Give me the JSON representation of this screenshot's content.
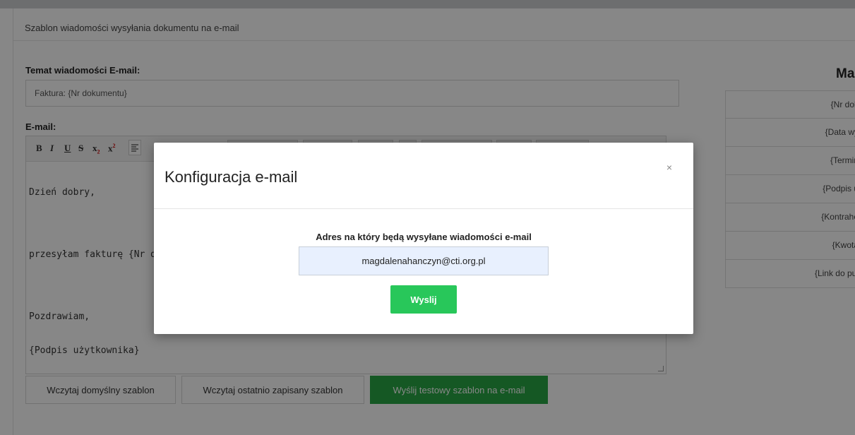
{
  "panel": {
    "title": "Szablon wiadomości wysyłania dokumentu na e-mail",
    "subject_label": "Temat wiadomości E-mail:",
    "subject_value": "Faktura: {Nr dokumentu}",
    "email_label": "E-mail:"
  },
  "toolbar": {
    "bold": "B",
    "italic": "I",
    "underline": "U",
    "strike": "S",
    "subscript": "x",
    "superscript": "x"
  },
  "editor": {
    "lines": [
      "Dzień dobry,",
      "",
      "przesyłam fakturę {Nr dok",
      "",
      "Pozdrawiam,",
      "{Podpis użytkownika}"
    ]
  },
  "buttons": {
    "load_default": "Wczytaj domyślny szablon",
    "load_saved": "Wczytaj ostatnio zapisany szablon",
    "send_test": "Wyślij testowy szablon na e-mail"
  },
  "right": {
    "heading": "Ma",
    "tags": [
      "{Nr dok",
      "{Data wy",
      "{Termin",
      "{Podpis u",
      "{Kontrahe",
      "{Kwota",
      "{Link do pul"
    ]
  },
  "modal": {
    "title": "Konfiguracja e-mail",
    "close": "×",
    "address_label": "Adres na który będą wysyłane wiadomości e-mail",
    "address_value": "magdalenahanczyn@cti.org.pl",
    "send_label": "Wyslij"
  },
  "colors": {
    "overlay": "#000000",
    "green": "#28a745",
    "send_green": "#28c75a",
    "input_autofill": "#e8f0fe"
  }
}
